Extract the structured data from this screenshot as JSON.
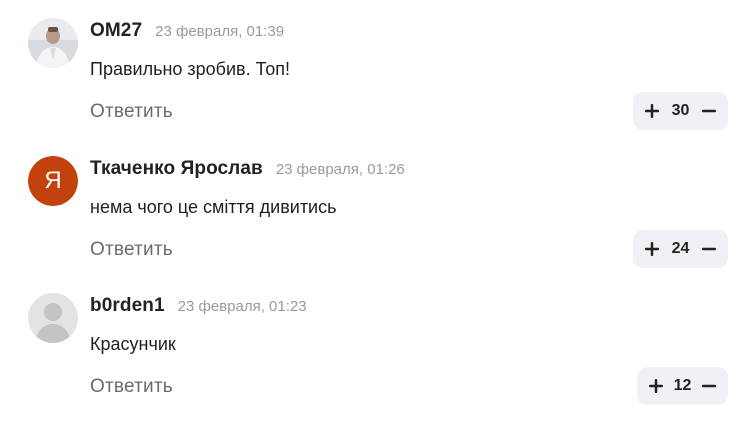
{
  "comments": [
    {
      "author": "ОМ27",
      "date": "23 февраля, 01:39",
      "text": "Правильно зробив. Топ!",
      "reply_label": "Ответить",
      "score": "30",
      "avatar": {
        "type": "photo",
        "colors": {
          "bg": "#cfd3d8",
          "figure": "#f2f2f2"
        }
      }
    },
    {
      "author": "Ткаченко Ярослав",
      "date": "23 февраля, 01:26",
      "text": "нема чого це сміття дивитись",
      "reply_label": "Ответить",
      "score": "24",
      "avatar": {
        "type": "letter",
        "letter": "Я",
        "color": "#c2410c"
      }
    },
    {
      "author": "b0rden1",
      "date": "23 февраля, 01:23",
      "text": "Красунчик",
      "reply_label": "Ответить",
      "score": "12",
      "avatar": {
        "type": "placeholder",
        "colors": {
          "bg": "#e3e3e3",
          "figure": "#c4c4c4"
        }
      }
    }
  ],
  "icons": {
    "upvote": "plus-icon",
    "downvote": "minus-icon"
  }
}
